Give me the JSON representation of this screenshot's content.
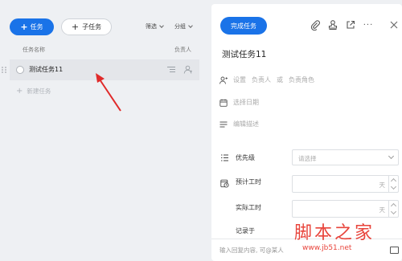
{
  "toolbar": {
    "task_label": "任务",
    "subtask_label": "子任务",
    "filter_label": "筛选",
    "group_label": "分组"
  },
  "columns": {
    "name": "任务名称",
    "owner": "负责人"
  },
  "tasks": [
    {
      "title": "测试任务11"
    }
  ],
  "new_task": "新建任务",
  "detail": {
    "complete_label": "完成任务",
    "title": "测试任务11",
    "assignee_prefix": "设置",
    "assignee_owner": "负责人",
    "assignee_or": "或",
    "assignee_role": "负责角色",
    "date_placeholder": "选择日期",
    "desc_placeholder": "编辑描述",
    "priority_label": "优先级",
    "priority_placeholder": "请选择",
    "estimate_label": "预计工时",
    "actual_label": "实际工时",
    "unit": "天",
    "record_label": "记录于",
    "comment_placeholder": "输入回复内容, 可@某人"
  },
  "watermark": {
    "main": "脚本之家",
    "sub": "www.jb51.net"
  },
  "colors": {
    "accent": "#1a73e8",
    "arrow": "#e02a2a",
    "watermark": "#e8443b"
  }
}
